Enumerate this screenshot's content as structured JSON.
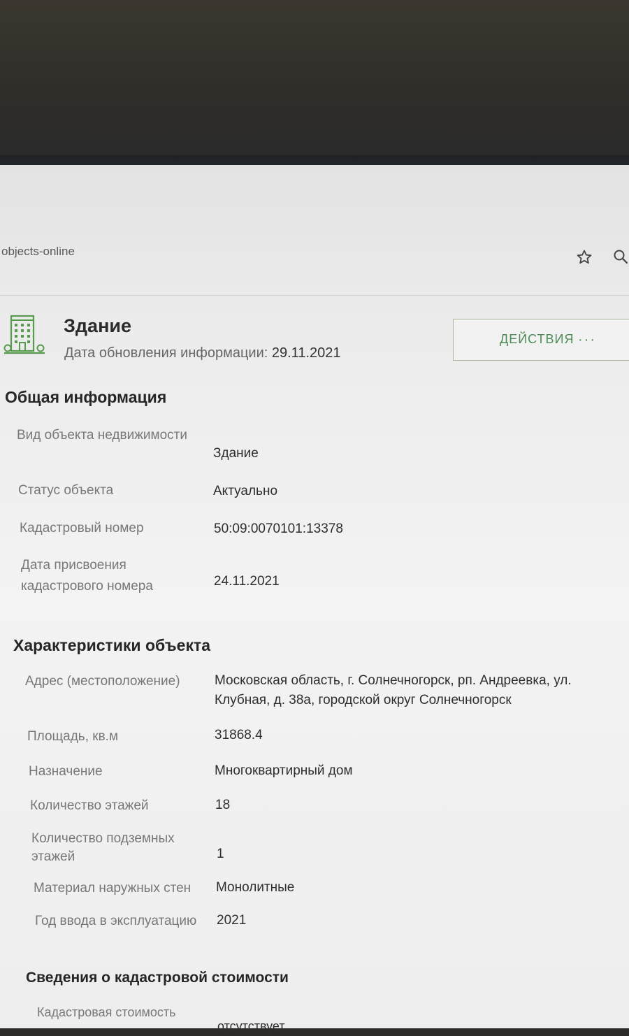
{
  "browser": {
    "url": "objects-online"
  },
  "header": {
    "title": "Здание",
    "update_label": "Дата обновления информации:",
    "update_date": "29.11.2021",
    "actions_label": "ДЕЙСТВИЯ",
    "actions_dots": "···"
  },
  "general": {
    "title": "Общая информация",
    "rows": [
      {
        "label": "Вид объекта недвижимости",
        "value": "Здание"
      },
      {
        "label": "Статус объекта",
        "value": "Актуально"
      },
      {
        "label": "Кадастровый номер",
        "value": "50:09:0070101:13378"
      },
      {
        "label": "Дата присвоения кадастрового номера",
        "value": "24.11.2021"
      }
    ]
  },
  "characteristics": {
    "title": "Характеристики объекта",
    "rows": [
      {
        "label": "Адрес (местоположение)",
        "value": "Московская область, г. Солнечногорск, рп. Андреевка, ул. Клубная, д. 38а, городской округ Солнечногорск"
      },
      {
        "label": "Площадь, кв.м",
        "value": "31868.4"
      },
      {
        "label": "Назначение",
        "value": "Многоквартирный дом"
      },
      {
        "label": "Количество этажей",
        "value": "18"
      },
      {
        "label": "Количество подземных этажей",
        "value": "1"
      },
      {
        "label": "Материал наружных стен",
        "value": "Монолитные"
      },
      {
        "label": "Год ввода в эксплуатацию",
        "value": "2021"
      }
    ]
  },
  "cadastral_value": {
    "title": "Сведения о кадастровой стоимости",
    "rows": [
      {
        "label": "Кадастровая стоимость",
        "value": "отсутствует"
      }
    ]
  },
  "colors": {
    "accent_green": "#4e8a55",
    "icon_green": "#5a9a4e"
  }
}
